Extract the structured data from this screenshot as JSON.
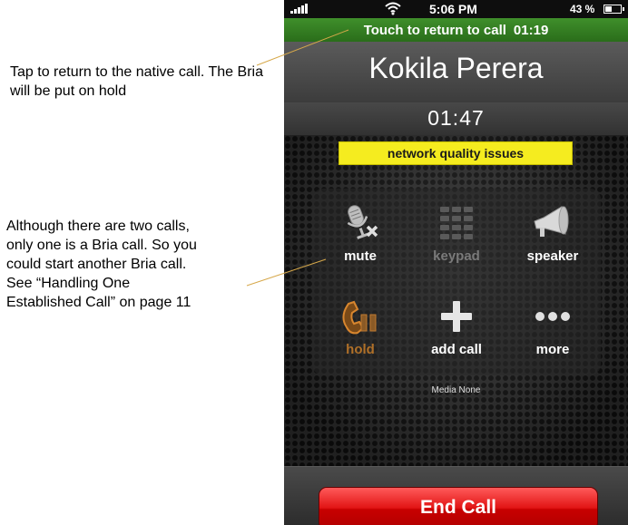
{
  "annotations": {
    "callout_1": "Tap to return to the native call. The Bria will be put on hold",
    "callout_2_lines": [
      "Although there are two calls,",
      "only one is a Bria call. So you",
      "could start another Bria call.",
      "See “Handling One",
      "Established Call” on page 11"
    ]
  },
  "status_bar": {
    "time": "5:06 PM",
    "battery": "43 %",
    "battery_level": 0.43,
    "icons": [
      "signal-icon",
      "wifi-icon",
      "battery-icon"
    ]
  },
  "return_bar": {
    "label": "Touch to return to call",
    "timer": "01:19"
  },
  "call": {
    "caller_name": "Kokila Perera",
    "duration": "01:47",
    "quality_warning": "network quality issues"
  },
  "controls": [
    {
      "id": "mute",
      "label": "mute",
      "icon": "microphone-muted-icon",
      "enabled": true
    },
    {
      "id": "keypad",
      "label": "keypad",
      "icon": "keypad-icon",
      "enabled": false
    },
    {
      "id": "speaker",
      "label": "speaker",
      "icon": "speaker-icon",
      "enabled": true
    },
    {
      "id": "hold",
      "label": "hold",
      "icon": "hold-phone-icon",
      "enabled": true
    },
    {
      "id": "add-call",
      "label": "add call",
      "icon": "plus-icon",
      "enabled": true
    },
    {
      "id": "more",
      "label": "more",
      "icon": "ellipsis-icon",
      "enabled": true
    }
  ],
  "media_status": "Media None",
  "end_call_label": "End Call",
  "colors": {
    "return_bar": "#2f7a20",
    "quality_banner": "#f5ec1f",
    "end_call": "#e21515",
    "hold_accent": "#b07028"
  }
}
